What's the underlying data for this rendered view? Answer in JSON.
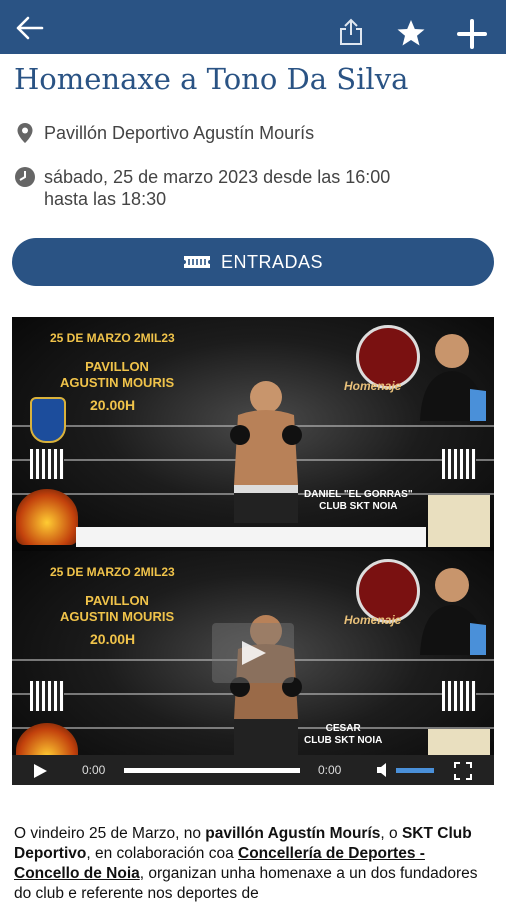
{
  "appbar": {
    "back_icon": "arrow-left-icon",
    "share_icon": "share-icon",
    "favorite_icon": "star-icon",
    "add_icon": "plus-icon",
    "color": "#2a5384"
  },
  "event": {
    "title": "Homenaxe a Tono Da Silva",
    "location": "Pavillón Deportivo Agustín Mourís",
    "datetime_line1": "sábado, 25 de marzo 2023 desde las 16:00",
    "datetime_line2": "hasta las 18:30"
  },
  "tickets_button": {
    "label": "ENTRADAS",
    "icon": "ticket-icon"
  },
  "video": {
    "poster_top": {
      "date": "25 DE MARZO 2MIL23",
      "venue_line1": "PAVILLON",
      "venue_line2": "AGUSTIN MOURIS",
      "time": "20.00H",
      "fighter_name_line1": "DANIEL \"EL GORRAS\"",
      "fighter_name_line2": "CLUB SKT NOIA",
      "tribute": "Homenaje"
    },
    "poster_bottom": {
      "date": "25 DE MARZO 2MIL23",
      "venue_line1": "PAVILLON",
      "venue_line2": "AGUSTIN MOURIS",
      "time": "20.00H",
      "fighter_name_line1": "CESAR",
      "fighter_name_line2": "CLUB SKT NOIA",
      "tribute": "Homenaje"
    },
    "current_time": "0:00",
    "duration": "0:00",
    "progress": 0
  },
  "description": {
    "p1": "O vindeiro 25 de Marzo, no ",
    "b1": "pavillón Agustín Mourís",
    "p2": ", o ",
    "b2": "SKT Club Deportivo",
    "p3": ", en colaboración coa ",
    "b3": "Concellería de Deportes - Concello de Noia",
    "p4": ", organizan unha homenaxe a un dos fundadores do club e referente nos deportes de"
  }
}
